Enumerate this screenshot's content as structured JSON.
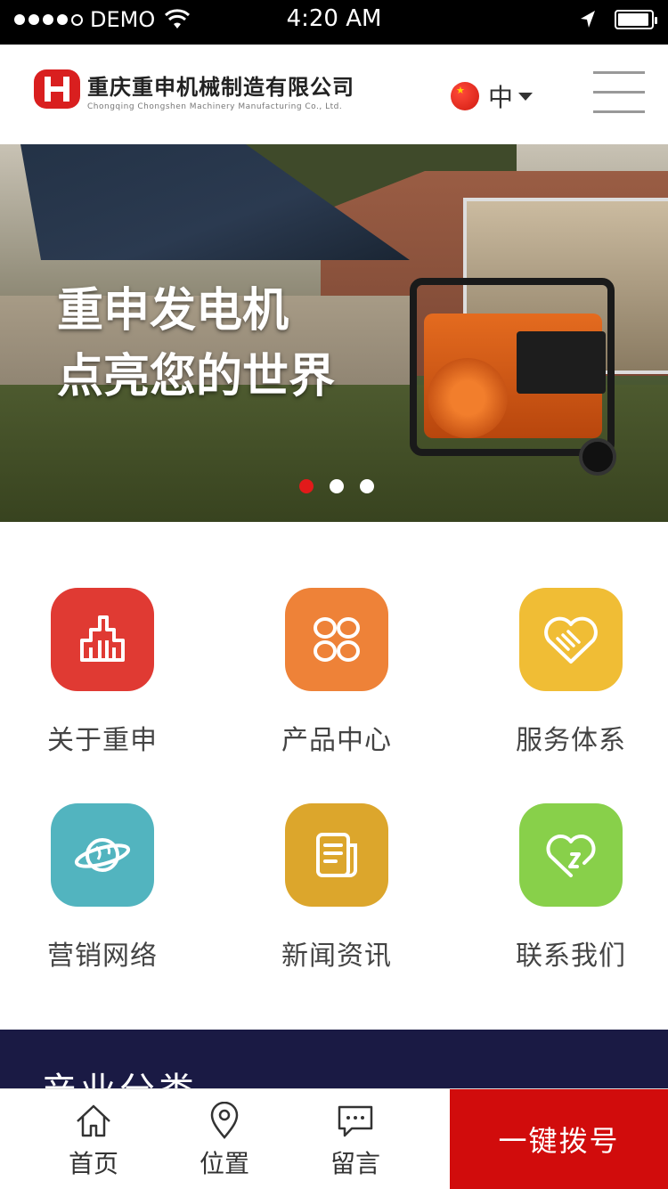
{
  "status_bar": {
    "carrier": "DEMO",
    "time": "4:20 AM"
  },
  "header": {
    "brand_cn": "重庆重申机械制造有限公司",
    "brand_en": "Chongqing Chongshen Machinery Manufacturing Co., Ltd.",
    "language": "中",
    "logo_icon": "ch-logo-icon",
    "menu_icon": "hamburger-menu-icon"
  },
  "banner": {
    "line1": "重申发电机",
    "line2": "点亮您的世界",
    "slides_total": 3,
    "active_slide": 1
  },
  "features": [
    {
      "label": "关于重申",
      "icon": "building-icon",
      "color": "#e03a33"
    },
    {
      "label": "产品中心",
      "icon": "grid-four-icon",
      "color": "#ee8238"
    },
    {
      "label": "服务体系",
      "icon": "handshake-heart-icon",
      "color": "#f0bd35"
    },
    {
      "label": "营销网络",
      "icon": "planet-icon",
      "color": "#52b4bf"
    },
    {
      "label": "新闻资讯",
      "icon": "newspaper-icon",
      "color": "#dca62c"
    },
    {
      "label": "联系我们",
      "icon": "heart-chat-icon",
      "color": "#88d04a"
    }
  ],
  "section": {
    "title": "产业分类"
  },
  "bottom_nav": {
    "home": "首页",
    "location": "位置",
    "message": "留言",
    "call": "一键拨号"
  },
  "colors": {
    "accent_red": "#d10c0c",
    "dark_section": "#1a1a44"
  }
}
